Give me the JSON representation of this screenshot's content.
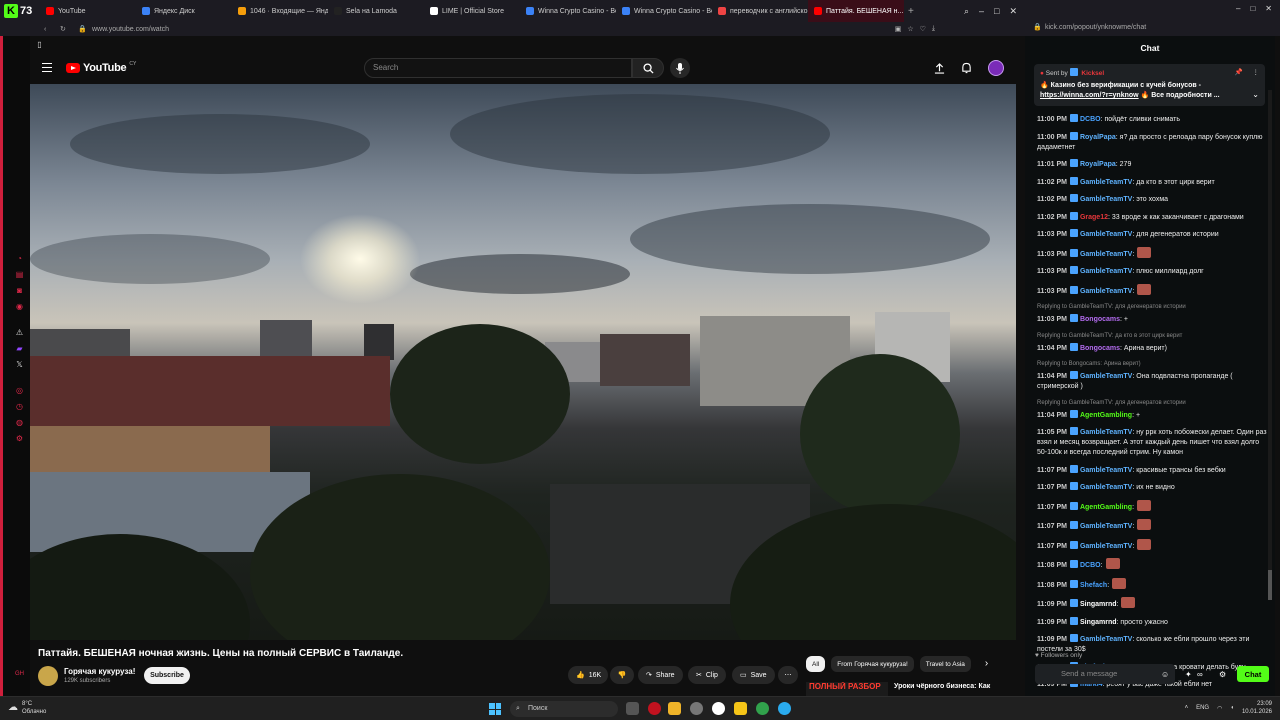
{
  "browser": {
    "tabs": [
      {
        "label": "YouTube",
        "color": "#ff0000"
      },
      {
        "label": "Яндекс Диск",
        "color": "#3b82f6"
      },
      {
        "label": "1046 · Входящие — Янд...",
        "color": "#f59e0b"
      },
      {
        "label": "Sela на Lamoda",
        "color": "#222222"
      },
      {
        "label": "LIME | Official Store",
        "color": "#ffffff"
      },
      {
        "label": "Winna Crypto Casino - Be...",
        "color": "#3b82f6"
      },
      {
        "label": "Winna Crypto Casino - Be...",
        "color": "#3b82f6"
      },
      {
        "label": "переводчик с английско...",
        "color": "#ef4444"
      },
      {
        "label": "Паттайя. БЕШЕНАЯ н...",
        "color": "#ff0000"
      }
    ],
    "badge_number": "73",
    "url": "www.youtube.com/watch",
    "chat_url": "kick.com/popout/ynknowme/chat"
  },
  "youtube": {
    "logo_text": "YouTube",
    "country": "CY",
    "search_placeholder": "Search",
    "video_title": "Паттайя. БЕШЕНАЯ ночная жизнь. Цены на полный СЕРВИС в Таиланде.",
    "channel_name": "Горячая кукуруза!",
    "channel_subs": "129K subscribers",
    "subscribe_label": "Subscribe",
    "like_count": "16K",
    "share_label": "Share",
    "clip_label": "Clip",
    "save_label": "Save",
    "chips": [
      "All",
      "From Горячая кукуруза!",
      "Travel to Asia"
    ],
    "rec_thumb_text": "ПОЛНЫЙ РАЗБОР",
    "rec_title": "Уроки чёрного бизнеса: Как"
  },
  "chat": {
    "header": "Chat",
    "pinned_sent_by": "Sent by",
    "pinned_user": "Kicksel",
    "pinned_text_1": "Казино без верификации с кучей бонусов -",
    "pinned_link": "https://winna.com/?r=ynknow",
    "pinned_text_2": "Все подробности ...",
    "messages": [
      {
        "time": "11:00 PM",
        "user": "DCBO",
        "color": "#4aa3ff",
        "text": ": пойдёт сливки снимать"
      },
      {
        "time": "11:00 PM",
        "user": "RoyalPapa",
        "color": "#5fb3ff",
        "text": ": я? да просто с релоада пару бонусок куплю дадаметнет"
      },
      {
        "time": "11:01 PM",
        "user": "RoyalPapa",
        "color": "#5fb3ff",
        "text": ": 279"
      },
      {
        "time": "11:02 PM",
        "user": "GambleTeamTV",
        "color": "#5fb3ff",
        "text": ": да кто в этот цирк верит"
      },
      {
        "time": "11:02 PM",
        "user": "GambleTeamTV",
        "color": "#5fb3ff",
        "text": ": это хохма"
      },
      {
        "time": "11:02 PM",
        "user": "Grage12",
        "color": "#e8373b",
        "text": ": 33 вроде ж как заканчивает с драгонами"
      },
      {
        "time": "11:03 PM",
        "user": "GambleTeamTV",
        "color": "#5fb3ff",
        "text": ": для дегенератов истории"
      },
      {
        "time": "11:03 PM",
        "user": "GambleTeamTV",
        "color": "#5fb3ff",
        "text": ":",
        "emote": true
      },
      {
        "time": "11:03 PM",
        "user": "GambleTeamTV",
        "color": "#5fb3ff",
        "text": ": плюс миллиард долг"
      },
      {
        "time": "11:03 PM",
        "user": "GambleTeamTV",
        "color": "#5fb3ff",
        "text": ":",
        "emote": true
      },
      {
        "reply": "Replying to GambleTeamTV: для дегенератов истории",
        "time": "11:03 PM",
        "user": "Bongocams",
        "color": "#b46cf0",
        "text": ": +"
      },
      {
        "reply": "Replying to GambleTeamTV: да кто в этот цирк верит",
        "time": "11:04 PM",
        "user": "Bongocams",
        "color": "#b46cf0",
        "text": ": Арина верит)"
      },
      {
        "reply": "Replying to Bongocams: Арина верит)",
        "time": "11:04 PM",
        "user": "GambleTeamTV",
        "color": "#5fb3ff",
        "text": ": Она подвластна пропаганде ( стримерской )"
      },
      {
        "reply": "Replying to GambleTeamTV: для дегенератов истории",
        "time": "11:04 PM",
        "user": "AgentGambling",
        "color": "#53fc18",
        "text": ": +"
      },
      {
        "time": "11:05 PM",
        "user": "GambleTeamTV",
        "color": "#5fb3ff",
        "text": ": ну ррк хоть побожески делает. Один раз взял и месяц возвращает. А этот каждый день пишет что взял долго 50-100к и всегда последний стрим. Ну камон"
      },
      {
        "time": "11:07 PM",
        "user": "GambleTeamTV",
        "color": "#5fb3ff",
        "text": ": красивые трансы без вебки"
      },
      {
        "time": "11:07 PM",
        "user": "GambleTeamTV",
        "color": "#5fb3ff",
        "text": ": их не видно"
      },
      {
        "time": "11:07 PM",
        "user": "AgentGambling",
        "color": "#53fc18",
        "text": ":",
        "emote": true
      },
      {
        "time": "11:07 PM",
        "user": "GambleTeamTV",
        "color": "#5fb3ff",
        "text": ":",
        "emote": true
      },
      {
        "time": "11:07 PM",
        "user": "GambleTeamTV",
        "color": "#5fb3ff",
        "text": ":",
        "emote": true
      },
      {
        "time": "11:08 PM",
        "user": "DCBO",
        "color": "#4aa3ff",
        "text": ":",
        "emote": true
      },
      {
        "time": "11:08 PM",
        "user": "Shefach",
        "color": "#4aa3ff",
        "text": ":",
        "emote": true
      },
      {
        "time": "11:09 PM",
        "user": "Singamrnd",
        "color": "#ffffff",
        "text": ":",
        "emote": true
      },
      {
        "time": "11:09 PM",
        "user": "Singamrnd",
        "color": "#ffffff",
        "text": ": просто ужасно"
      },
      {
        "time": "11:09 PM",
        "user": "GambleTeamTV",
        "color": "#5fb3ff",
        "text": ": сколько же ебли прошло через эти постели за 30$"
      },
      {
        "time": "11:09 PM",
        "user": "Shefach",
        "color": "#4aa3ff",
        "text": ": растяжку говорит на кровати делать буду"
      },
      {
        "time": "11:09 PM",
        "user": "markl4",
        "color": "#4aa3ff",
        "text": ": ребят у вас даже такой ебли нет"
      }
    ],
    "followers_only": "Followers only",
    "input_placeholder": "Send a message",
    "send_label": "Chat"
  },
  "taskbar": {
    "weather_temp": "8°C",
    "weather_desc": "Облачно",
    "search_label": "Поиск",
    "lang": "ENG",
    "time": "23:09",
    "date": "10.01.2026"
  }
}
